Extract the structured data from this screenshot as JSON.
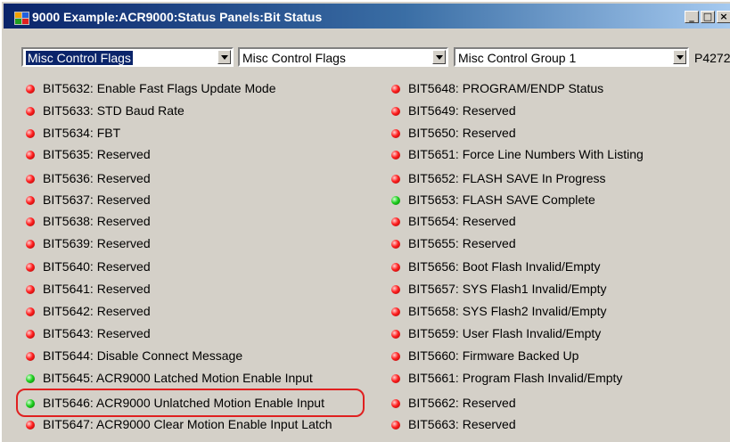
{
  "window": {
    "title": "9000 Example:ACR9000:Status Panels:Bit Status",
    "minimize_label": "_",
    "maximize_label": "□",
    "close_label": "×"
  },
  "toolbar": {
    "combo1": "Misc Control Flags",
    "combo2": "Misc Control Flags",
    "combo3": "Misc Control Group 1",
    "code": "P4272"
  },
  "bits_left": [
    {
      "label": "BIT5632:  Enable Fast Flags Update Mode",
      "state": "red"
    },
    {
      "label": "BIT5633:  STD Baud Rate",
      "state": "red"
    },
    {
      "label": "BIT5634:  FBT",
      "state": "red"
    },
    {
      "label": "BIT5635:  Reserved",
      "state": "red"
    },
    {
      "label": "BIT5636:  Reserved",
      "state": "red"
    },
    {
      "label": "BIT5637:  Reserved",
      "state": "red"
    },
    {
      "label": "BIT5638:  Reserved",
      "state": "red"
    },
    {
      "label": "BIT5639:  Reserved",
      "state": "red"
    },
    {
      "label": "BIT5640:  Reserved",
      "state": "red"
    },
    {
      "label": "BIT5641:  Reserved",
      "state": "red"
    },
    {
      "label": "BIT5642:  Reserved",
      "state": "red"
    },
    {
      "label": "BIT5643:  Reserved",
      "state": "red"
    },
    {
      "label": "BIT5644:  Disable Connect Message",
      "state": "red"
    },
    {
      "label": "BIT5645:  ACR9000 Latched Motion Enable Input",
      "state": "green"
    },
    {
      "label": "BIT5646:  ACR9000 Unlatched Motion Enable Input",
      "state": "green"
    },
    {
      "label": "BIT5647:  ACR9000 Clear Motion Enable Input Latch",
      "state": "red"
    }
  ],
  "bits_right": [
    {
      "label": "BIT5648:  PROGRAM/ENDP Status",
      "state": "red"
    },
    {
      "label": "BIT5649:  Reserved",
      "state": "red"
    },
    {
      "label": "BIT5650:  Reserved",
      "state": "red"
    },
    {
      "label": "BIT5651:  Force Line Numbers With Listing",
      "state": "red"
    },
    {
      "label": "BIT5652:  FLASH SAVE In Progress",
      "state": "red"
    },
    {
      "label": "BIT5653:  FLASH SAVE Complete",
      "state": "green"
    },
    {
      "label": "BIT5654:  Reserved",
      "state": "red"
    },
    {
      "label": "BIT5655:  Reserved",
      "state": "red"
    },
    {
      "label": "BIT5656:  Boot Flash Invalid/Empty",
      "state": "red"
    },
    {
      "label": "BIT5657:  SYS Flash1 Invalid/Empty",
      "state": "red"
    },
    {
      "label": "BIT5658:  SYS Flash2 Invalid/Empty",
      "state": "red"
    },
    {
      "label": "BIT5659:  User Flash Invalid/Empty",
      "state": "red"
    },
    {
      "label": "BIT5660:  Firmware Backed Up",
      "state": "red"
    },
    {
      "label": "BIT5661:  Program Flash Invalid/Empty",
      "state": "red"
    },
    {
      "label": "BIT5662:  Reserved",
      "state": "red"
    },
    {
      "label": "BIT5663:  Reserved",
      "state": "red"
    }
  ],
  "colors": {
    "titlebar_start": "#0a246a",
    "titlebar_end": "#a6caf0",
    "led_red": "#ff2020",
    "led_green": "#20d020",
    "highlight": "#e02020"
  }
}
